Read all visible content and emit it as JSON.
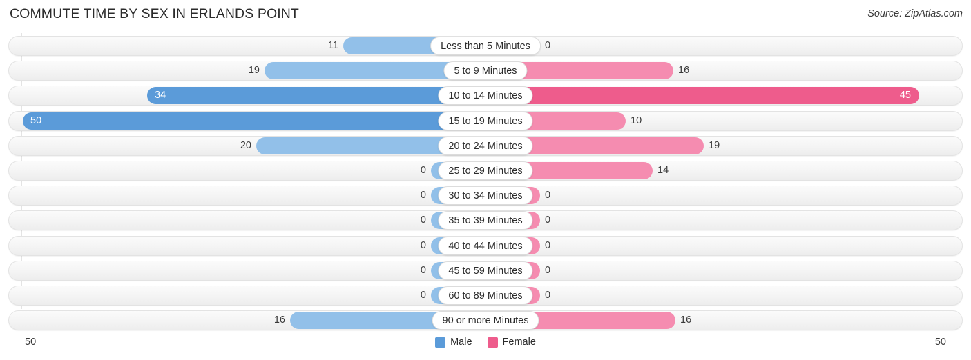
{
  "header": {
    "title": "COMMUTE TIME BY SEX IN ERLANDS POINT",
    "source": "Source: ZipAtlas.com"
  },
  "axis": {
    "left_max": "50",
    "right_max": "50"
  },
  "legend": [
    {
      "label": "Male",
      "color": "#5b9bd9"
    },
    {
      "label": "Female",
      "color": "#ee5c8c"
    }
  ],
  "colors": {
    "male_light": "#92c0e9",
    "male_dark": "#5b9bd9",
    "female_light": "#f58cb0",
    "female_dark": "#ee5c8c",
    "track": "#f4f4f4",
    "gridline": "#e4e4e4"
  },
  "chart_data": {
    "type": "bar",
    "orientation": "horizontal-diverging",
    "title": "COMMUTE TIME BY SEX IN ERLANDS POINT",
    "xlabel": "",
    "ylabel": "",
    "xlim": [
      50,
      50
    ],
    "grid": true,
    "legend_position": "bottom-center",
    "categories": [
      "Less than 5 Minutes",
      "5 to 9 Minutes",
      "10 to 14 Minutes",
      "15 to 19 Minutes",
      "20 to 24 Minutes",
      "25 to 29 Minutes",
      "30 to 34 Minutes",
      "35 to 39 Minutes",
      "40 to 44 Minutes",
      "45 to 59 Minutes",
      "60 to 89 Minutes",
      "90 or more Minutes"
    ],
    "series": [
      {
        "name": "Male",
        "values": [
          11,
          19,
          34,
          50,
          20,
          0,
          0,
          0,
          0,
          0,
          0,
          16
        ]
      },
      {
        "name": "Female",
        "values": [
          0,
          16,
          45,
          10,
          19,
          14,
          0,
          0,
          0,
          0,
          0,
          16
        ]
      }
    ]
  },
  "rows": [
    {
      "label": "Less than 5 Minutes",
      "male": "11",
      "female": "0",
      "male_w": 206,
      "female_w": 79,
      "male_tone": "light",
      "female_tone": "light",
      "male_inside": false,
      "female_inside": false
    },
    {
      "label": "5 to 9 Minutes",
      "male": "19",
      "female": "16",
      "male_w": 320,
      "female_w": 272,
      "male_tone": "light",
      "female_tone": "light",
      "male_inside": false,
      "female_inside": false
    },
    {
      "label": "10 to 14 Minutes",
      "male": "34",
      "female": "45",
      "male_w": 490,
      "female_w": 628,
      "male_tone": "dark",
      "female_tone": "dark",
      "male_inside": true,
      "female_inside": true
    },
    {
      "label": "15 to 19 Minutes",
      "male": "50",
      "female": "10",
      "male_w": 670,
      "female_w": 203,
      "male_tone": "dark",
      "female_tone": "light",
      "male_inside": true,
      "female_inside": false
    },
    {
      "label": "20 to 24 Minutes",
      "male": "20",
      "female": "19",
      "male_w": 332,
      "female_w": 316,
      "male_tone": "light",
      "female_tone": "light",
      "male_inside": false,
      "female_inside": false
    },
    {
      "label": "25 to 29 Minutes",
      "male": "0",
      "female": "14",
      "male_w": 79,
      "female_w": 242,
      "male_tone": "light",
      "female_tone": "light",
      "male_inside": false,
      "female_inside": false
    },
    {
      "label": "30 to 34 Minutes",
      "male": "0",
      "female": "0",
      "male_w": 79,
      "female_w": 79,
      "male_tone": "light",
      "female_tone": "light",
      "male_inside": false,
      "female_inside": false
    },
    {
      "label": "35 to 39 Minutes",
      "male": "0",
      "female": "0",
      "male_w": 79,
      "female_w": 79,
      "male_tone": "light",
      "female_tone": "light",
      "male_inside": false,
      "female_inside": false
    },
    {
      "label": "40 to 44 Minutes",
      "male": "0",
      "female": "0",
      "male_w": 79,
      "female_w": 79,
      "male_tone": "light",
      "female_tone": "light",
      "male_inside": false,
      "female_inside": false
    },
    {
      "label": "45 to 59 Minutes",
      "male": "0",
      "female": "0",
      "male_w": 79,
      "female_w": 79,
      "male_tone": "light",
      "female_tone": "light",
      "male_inside": false,
      "female_inside": false
    },
    {
      "label": "60 to 89 Minutes",
      "male": "0",
      "female": "0",
      "male_w": 79,
      "female_w": 79,
      "male_tone": "light",
      "female_tone": "light",
      "male_inside": false,
      "female_inside": false
    },
    {
      "label": "90 or more Minutes",
      "male": "16",
      "female": "16",
      "male_w": 283,
      "female_w": 275,
      "male_tone": "light",
      "female_tone": "light",
      "male_inside": false,
      "female_inside": false
    }
  ]
}
